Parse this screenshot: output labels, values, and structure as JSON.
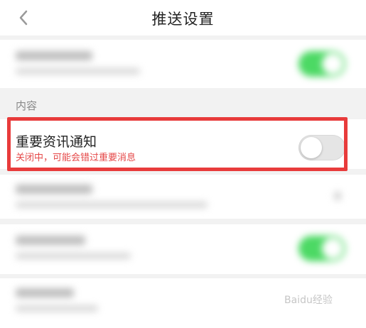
{
  "header": {
    "title": "推送设置",
    "back_icon": "chevron-left-icon"
  },
  "section": {
    "label": "内容"
  },
  "important_news": {
    "title": "重要资讯通知",
    "subtitle": "关闭中，可能会错过重要消息",
    "enabled": false
  },
  "colors": {
    "toggle_on": "#4cd964",
    "highlight_border": "#e83b3b",
    "subtitle_text": "#e54848"
  },
  "watermark": {
    "text": "Baidu经验"
  }
}
